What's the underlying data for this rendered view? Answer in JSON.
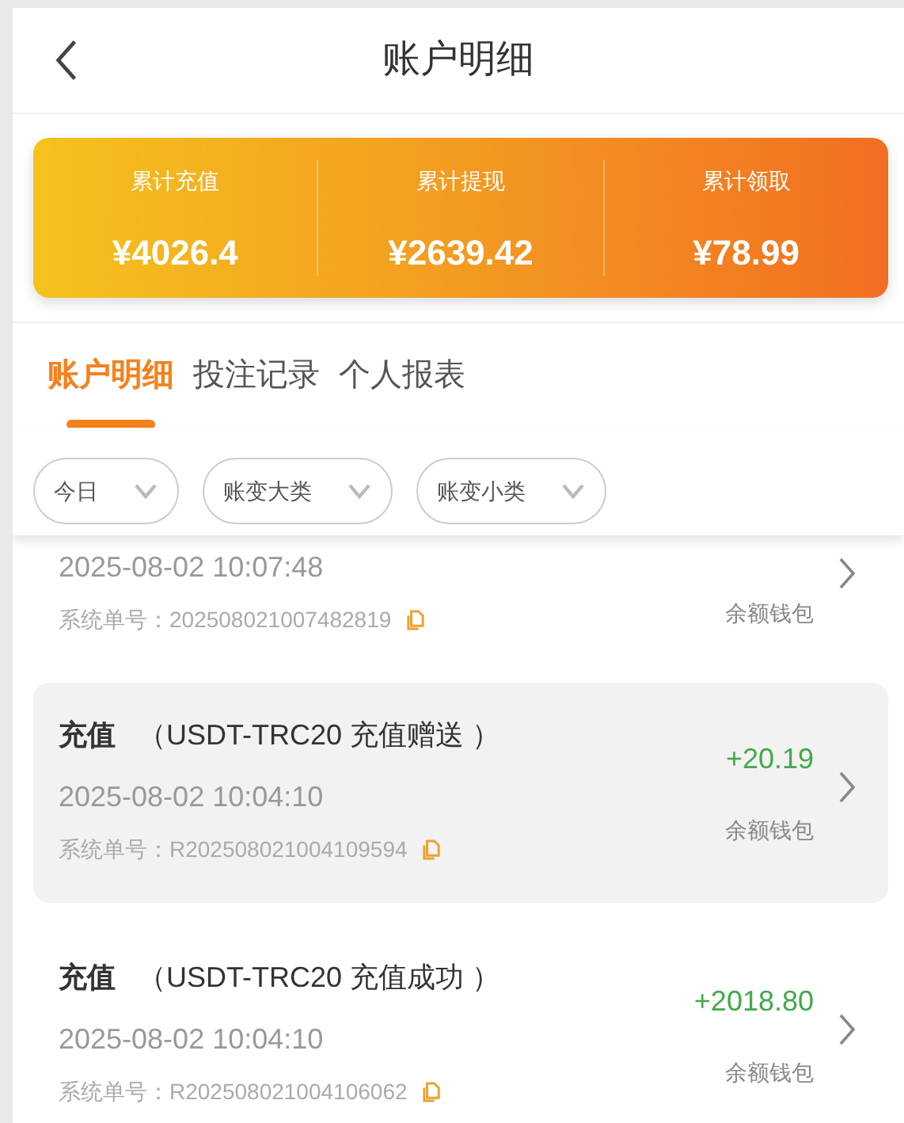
{
  "header": {
    "title": "账户明细"
  },
  "stats": [
    {
      "label": "累计充值",
      "value": "¥4026.4"
    },
    {
      "label": "累计提现",
      "value": "¥2639.42"
    },
    {
      "label": "累计领取",
      "value": "¥78.99"
    }
  ],
  "tabs": [
    {
      "label": "账户明细",
      "selected": true
    },
    {
      "label": "投注记录",
      "selected": false
    },
    {
      "label": "个人报表",
      "selected": false
    }
  ],
  "filters": [
    {
      "label": "今日"
    },
    {
      "label": "账变大类"
    },
    {
      "label": "账变小类"
    }
  ],
  "records": [
    {
      "kind": "partial",
      "time": "2025-08-02 10:07:48",
      "order_label": "系统单号：",
      "order_no": "202508021007482819",
      "wallet": "余额钱包",
      "highlighted": false
    },
    {
      "kind": "full",
      "type": "充值",
      "detail": "（USDT-TRC20 充值赠送 ）",
      "amount": "+20.19",
      "time": "2025-08-02 10:04:10",
      "order_label": "系统单号：",
      "order_no": "R202508021004109594",
      "wallet": "余额钱包",
      "highlighted": true
    },
    {
      "kind": "full",
      "type": "充值",
      "detail": "（USDT-TRC20 充值成功 ）",
      "amount": "+2018.80",
      "time": "2025-08-02 10:04:10",
      "order_label": "系统单号：",
      "order_no": "R202508021004106062",
      "wallet": "余额钱包",
      "highlighted": false
    }
  ]
}
